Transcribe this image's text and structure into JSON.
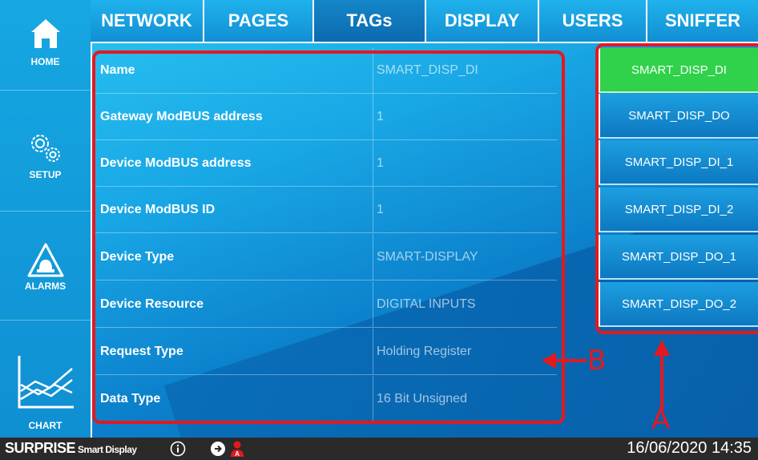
{
  "sidebar": {
    "items": [
      {
        "label": "HOME",
        "icon": "home-icon"
      },
      {
        "label": "SETUP",
        "icon": "gears-icon"
      },
      {
        "label": "ALARMS",
        "icon": "alarm-beacon-icon"
      },
      {
        "label": "CHART",
        "icon": "line-chart-icon"
      }
    ]
  },
  "tabs": [
    "NETWORK",
    "PAGES",
    "TAGs",
    "DISPLAY",
    "USERS",
    "SNIFFER"
  ],
  "active_tab": "TAGs",
  "properties": [
    {
      "label": "Name",
      "value": "SMART_DISP_DI"
    },
    {
      "label": "Gateway ModBUS address",
      "value": "1"
    },
    {
      "label": "Device ModBUS address",
      "value": "1"
    },
    {
      "label": "Device ModBUS ID",
      "value": "1"
    },
    {
      "label": "Device Type",
      "value": "SMART-DISPLAY"
    },
    {
      "label": "Device Resource",
      "value": "DIGITAL INPUTS"
    },
    {
      "label": "Request Type",
      "value": "Holding Register"
    },
    {
      "label": "Data Type",
      "value": "16 Bit Unsigned"
    }
  ],
  "tag_list": [
    "SMART_DISP_DI",
    "SMART_DISP_DO",
    "SMART_DISP_DI_1",
    "SMART_DISP_DI_2",
    "SMART_DISP_DO_1",
    "SMART_DISP_DO_2"
  ],
  "selected_tag": "SMART_DISP_DI",
  "annotations": {
    "a": "A",
    "b": "B"
  },
  "statusbar": {
    "brand": "SURPRISE",
    "brand_sub": "Smart Display",
    "datetime": "16/06/2020 14:35"
  },
  "colors": {
    "accent_red": "#e4191e",
    "selected_green": "#2fd24a",
    "panel_blue": "#1596d8"
  }
}
